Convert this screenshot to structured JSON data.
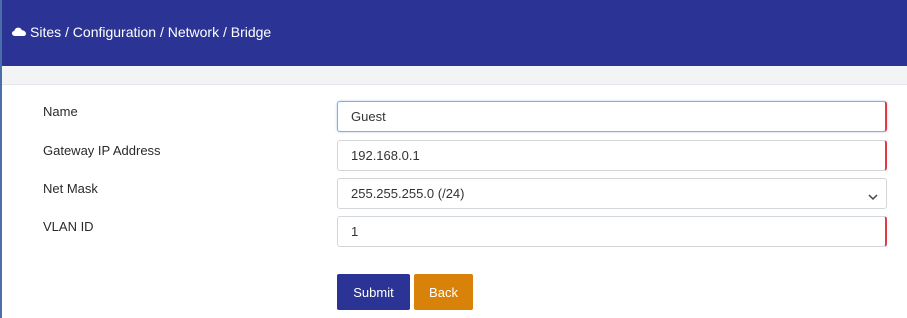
{
  "header": {
    "breadcrumb": "Sites / Configuration / Network / Bridge",
    "icon": "cloud-icon",
    "background": "#2b3495"
  },
  "form": {
    "name": {
      "label": "Name",
      "value": "Guest"
    },
    "gateway": {
      "label": "Gateway IP Address",
      "value": "192.168.0.1"
    },
    "netmask": {
      "label": "Net Mask",
      "selected": "255.255.255.0 (/24)"
    },
    "vlan": {
      "label": "VLAN ID",
      "value": "1"
    }
  },
  "buttons": {
    "submit": "Submit",
    "back": "Back"
  },
  "colors": {
    "primary": "#2b3495",
    "back": "#d9820a",
    "required_marker": "#e5393f"
  }
}
